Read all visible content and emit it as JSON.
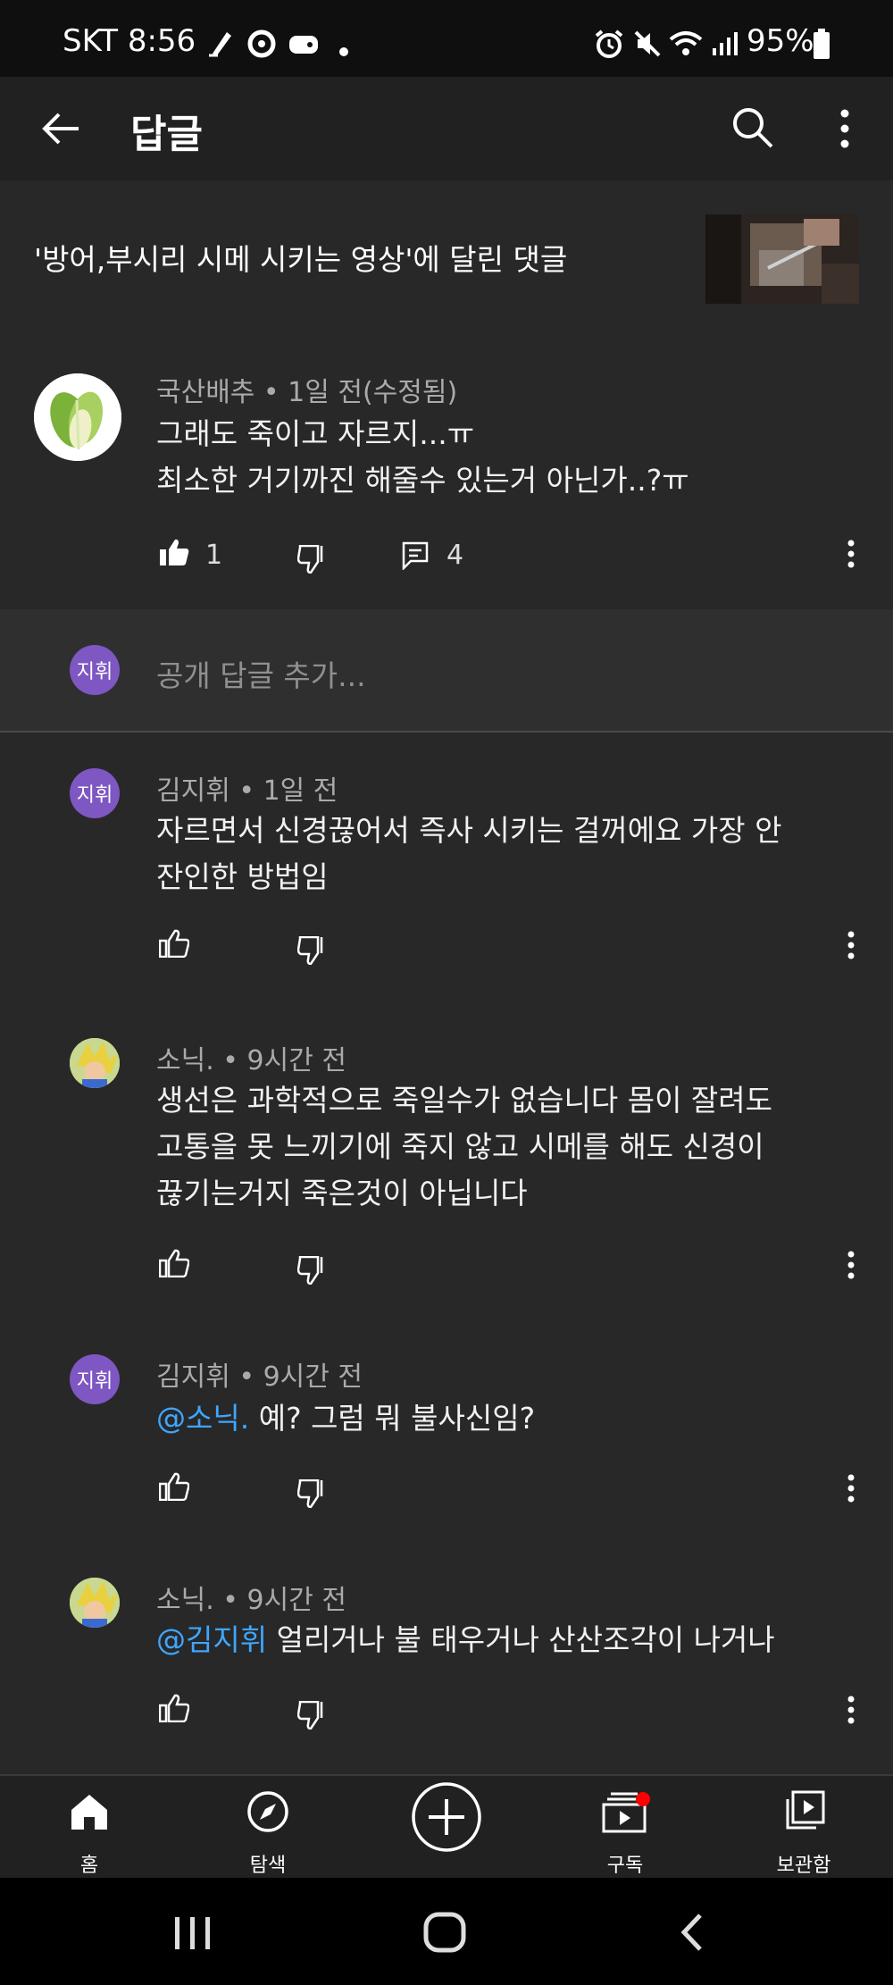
{
  "status_bar": {
    "carrier_time": "SKT 8:56",
    "battery": "95%"
  },
  "app_bar": {
    "title": "답글"
  },
  "video": {
    "title": "'방어,부시리 시메 시키는 영상'에 달린 댓글"
  },
  "parent_comment": {
    "author_meta": "국산배추 • 1일 전(수정됨)",
    "lines": [
      "그래도 죽이고 자르지...ㅠ",
      "최소한 거기까진 해줄수 있는거 아닌가..?ㅠ"
    ],
    "likes": "1",
    "replies": "4"
  },
  "add_reply": {
    "avatar_text": "지휘",
    "placeholder": "공개 답글 추가..."
  },
  "replies": [
    {
      "author_meta": "김지휘 • 1일 전",
      "avatar_text": "지휘",
      "lines": [
        "자르면서 신경끊어서 즉사 시키는 걸꺼에요 가장 안",
        "잔인한 방법임"
      ]
    },
    {
      "author_meta": "소닉. • 9시간 전",
      "lines": [
        "생선은 과학적으로 죽일수가 없습니다 몸이 잘려도",
        "고통을 못 느끼기에 죽지 않고 시메를 해도 신경이",
        "끊기는거지 죽은것이 아닙니다"
      ]
    },
    {
      "author_meta": "김지휘 • 9시간 전",
      "avatar_text": "지휘",
      "mention": "@소닉.",
      "text": " 예? 그럼 뭐 불사신임?"
    },
    {
      "author_meta": "소닉. • 9시간 전",
      "mention": "@김지휘",
      "text": " 얼리거나 불 태우거나 산산조각이 나거나"
    }
  ],
  "bottom_nav": {
    "home": "홈",
    "explore": "탐색",
    "subscriptions": "구독",
    "library": "보관함"
  },
  "colors": {
    "background": "#282828",
    "mention": "#3ea6ff",
    "avatar_purple": "#7e57c2",
    "notification_dot": "#ff0000"
  }
}
